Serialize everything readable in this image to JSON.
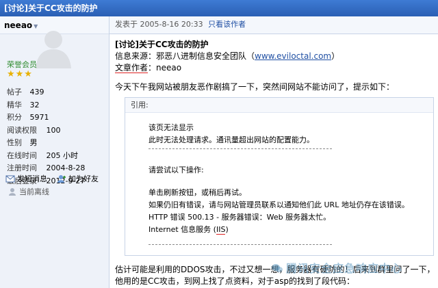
{
  "title_bar": {
    "title": "[讨论]关于CC攻击的防护"
  },
  "sidebar": {
    "username": "neeao",
    "rank": "荣誉会员",
    "stars": "★★★",
    "stats": [
      {
        "label": "帖子",
        "value": "439"
      },
      {
        "label": "精华",
        "value": "32"
      },
      {
        "label": "积分",
        "value": "5971"
      },
      {
        "label": "阅读权限",
        "value": "100"
      },
      {
        "label": "性别",
        "value": "男"
      },
      {
        "label": "在线时间",
        "value": "205 小时"
      },
      {
        "label": "注册时间",
        "value": "2004-8-28"
      },
      {
        "label": "最后登录",
        "value": "2012-9-27"
      }
    ],
    "send_message": "发短消息",
    "add_friend": "加为好友",
    "status": "当前离线"
  },
  "post": {
    "posted_at": "发表于 2005-8-16 20:33",
    "only_author": "只看该作者",
    "title": "[讨论]关于CC攻击的防护",
    "source_label": "信息来源：邪恶八进制信息安全团队（",
    "source_link": "www.eviloctal.com",
    "source_end": "）",
    "author_label": "文章作者",
    "author_value": "：neeao",
    "intro": "今天下午我网站被朋友恶作剧搞了一下，突然间网站不能访问了，提示如下：",
    "quote_label": "引用:",
    "quote_lines": {
      "l1": "该页无法显示",
      "l2": "此时无法处理请求。通讯量超出网站的配置能力。",
      "l3": "请尝试以下操作:",
      "l4": "单击刷新按钮，或稍后再试。",
      "l5": "如果仍旧有错误，请与网站管理员联系以通知他们此 URL 地址仍存在该错误。",
      "l6": "HTTP 错误 500.13 - 服务器错误：Web 服务器太忙。",
      "l7a": "Internet 信息服务 (",
      "l7b": "IIS",
      "l7c": ")"
    },
    "outro_1": "估计可能是利用的DDOS攻击，不过又想一想，服务器有硬防的！后来到群里问了一下，",
    "outro_2": "他用的是CC攻击，到网上找了点资料，对于asp的找到了段代码："
  },
  "watermark": "腾讯安全应急响应中心",
  "colors": {
    "title_bar": "#2a5fb4",
    "sidebar_bg": "#eef2f9",
    "link": "#1f4fa3",
    "rank": "#2d8a2d",
    "stars": "#e8b100"
  }
}
